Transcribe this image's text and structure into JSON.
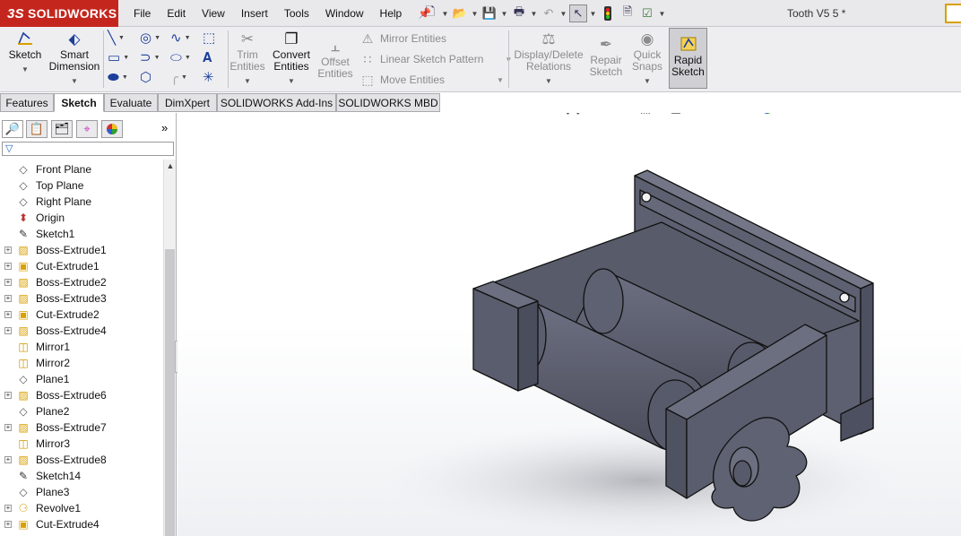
{
  "app": {
    "brand": "SOLIDWORKS",
    "brand_mark": "3S",
    "document_title": "Tooth V5 5 *"
  },
  "menu": [
    "File",
    "Edit",
    "View",
    "Insert",
    "Tools",
    "Window",
    "Help"
  ],
  "command_manager": {
    "sketch": "Sketch",
    "smart_dimension": [
      "Smart",
      "Dimension"
    ],
    "trim_entities": [
      "Trim",
      "Entities"
    ],
    "convert_entities": [
      "Convert",
      "Entities"
    ],
    "offset_entities": [
      "Offset",
      "Entities"
    ],
    "mirror_entities": "Mirror Entities",
    "linear_sketch_pattern": "Linear Sketch Pattern",
    "move_entities": "Move Entities",
    "display_delete_relations": [
      "Display/Delete",
      "Relations"
    ],
    "repair_sketch": [
      "Repair",
      "Sketch"
    ],
    "quick_snaps": [
      "Quick",
      "Snaps"
    ],
    "rapid_sketch": [
      "Rapid",
      "Sketch"
    ]
  },
  "tabs": [
    "Features",
    "Sketch",
    "Evaluate",
    "DimXpert",
    "SOLIDWORKS Add-Ins",
    "SOLIDWORKS MBD"
  ],
  "active_tab": "Sketch",
  "feature_tree": [
    {
      "label": "Front Plane",
      "icon": "plane-icon",
      "expandable": false
    },
    {
      "label": "Top Plane",
      "icon": "plane-icon",
      "expandable": false
    },
    {
      "label": "Right Plane",
      "icon": "plane-icon",
      "expandable": false
    },
    {
      "label": "Origin",
      "icon": "origin-icon",
      "expandable": false
    },
    {
      "label": "Sketch1",
      "icon": "sketch-icon",
      "expandable": false
    },
    {
      "label": "Boss-Extrude1",
      "icon": "boss-extrude-icon",
      "expandable": true
    },
    {
      "label": "Cut-Extrude1",
      "icon": "cut-extrude-icon",
      "expandable": true
    },
    {
      "label": "Boss-Extrude2",
      "icon": "boss-extrude-icon",
      "expandable": true
    },
    {
      "label": "Boss-Extrude3",
      "icon": "boss-extrude-icon",
      "expandable": true
    },
    {
      "label": "Cut-Extrude2",
      "icon": "cut-extrude-icon",
      "expandable": true
    },
    {
      "label": "Boss-Extrude4",
      "icon": "boss-extrude-icon",
      "expandable": true
    },
    {
      "label": "Mirror1",
      "icon": "mirror-icon",
      "expandable": false
    },
    {
      "label": "Mirror2",
      "icon": "mirror-icon",
      "expandable": false
    },
    {
      "label": "Plane1",
      "icon": "plane-icon",
      "expandable": false
    },
    {
      "label": "Boss-Extrude6",
      "icon": "boss-extrude-icon",
      "expandable": true
    },
    {
      "label": "Plane2",
      "icon": "plane-icon",
      "expandable": false
    },
    {
      "label": "Boss-Extrude7",
      "icon": "boss-extrude-icon",
      "expandable": true
    },
    {
      "label": "Mirror3",
      "icon": "mirror-icon",
      "expandable": false
    },
    {
      "label": "Boss-Extrude8",
      "icon": "boss-extrude-icon",
      "expandable": true
    },
    {
      "label": "Sketch14",
      "icon": "sketch-icon",
      "expandable": false
    },
    {
      "label": "Plane3",
      "icon": "plane-icon",
      "expandable": false
    },
    {
      "label": "Revolve1",
      "icon": "revolve-icon",
      "expandable": true
    },
    {
      "label": "Cut-Extrude4",
      "icon": "cut-extrude-icon",
      "expandable": true
    }
  ],
  "colors": {
    "brand_red": "#c4261d",
    "model_body": "#5d6070",
    "model_edge": "#111111",
    "highlight_orange": "#d8a000"
  }
}
